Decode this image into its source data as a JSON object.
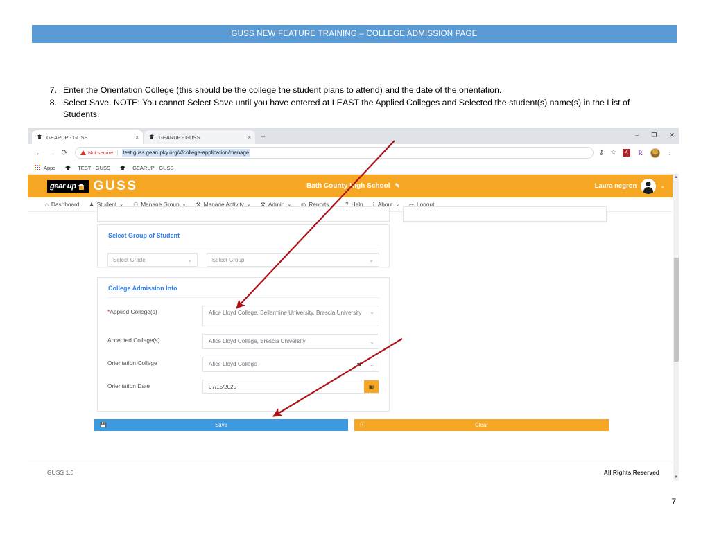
{
  "slide": {
    "banner_title": "GUSS NEW FEATURE TRAINING – COLLEGE ADMISSION PAGE",
    "page_number": "7",
    "instructions": [
      {
        "number": "7.",
        "text": "Enter the Orientation College (this should be the college the student plans to attend) and the date of the orientation."
      },
      {
        "number": "8.",
        "text": "Select Save. NOTE: You cannot Select Save until you have entered at LEAST the Applied Colleges and Selected the student(s) name(s) in the List of Students."
      }
    ],
    "accent_banner_color": "#5b9bd5",
    "annotation_arrow_color": "#b01116"
  },
  "browser": {
    "tabs": [
      {
        "title": "GEARUP - GUSS",
        "close": "×",
        "favicon": "gearup-favicon"
      },
      {
        "title": "GEARUP - GUSS",
        "close": "×",
        "favicon": "gearup-favicon"
      }
    ],
    "new_tab": "+",
    "window_controls": {
      "minimize": "–",
      "maximize": "❐",
      "close": "✕"
    },
    "nav": {
      "back": "←",
      "forward": "→",
      "reload": "⟳"
    },
    "security_label": "Not secure",
    "url": "test.guss.gearupky.org/#/college-application/manage",
    "toolbar_icons": {
      "key": "⚷",
      "star": "☆",
      "ext_adobe": "A",
      "ext_r": "R",
      "menu": "⋮"
    },
    "bookmarks": [
      {
        "label": "Apps",
        "icon": "apps-grid-icon"
      },
      {
        "label": "TEST - GUSS",
        "icon": "gearup-favicon"
      },
      {
        "label": "GEARUP - GUSS",
        "icon": "gearup-favicon"
      }
    ]
  },
  "app": {
    "brand": {
      "logo_text": "gear up",
      "name": "GUSS"
    },
    "school_name": "Bath County High School",
    "school_edit_icon": "✎",
    "user": {
      "name": "Laura negron",
      "caret": "⌄"
    },
    "nav_items": [
      {
        "label": "Dashboard",
        "icon": "⌂",
        "caret": ""
      },
      {
        "label": "Student",
        "icon": "♟",
        "caret": "⌄"
      },
      {
        "label": "Manage Group",
        "icon": "⚇",
        "caret": "⌄"
      },
      {
        "label": "Manage Activity",
        "icon": "⚒",
        "caret": "⌄"
      },
      {
        "label": "Admin",
        "icon": "⚒",
        "caret": "⌄"
      },
      {
        "label": "Reports",
        "icon": "◎",
        "caret": "⌄"
      },
      {
        "label": "Help",
        "icon": "?",
        "caret": ""
      },
      {
        "label": "About",
        "icon": "ℹ",
        "caret": "⌄"
      },
      {
        "label": "Logout",
        "icon": "↦",
        "caret": ""
      }
    ],
    "header_color": "#f5a623"
  },
  "group_card": {
    "title": "Select Group of Student",
    "grade_select": {
      "value": "Select Grade",
      "caret": "⌄"
    },
    "group_select": {
      "value": "Select Group",
      "caret": "⌄"
    }
  },
  "admission_card": {
    "title": "College Admission Info",
    "fields": [
      {
        "label": "Applied College(s)",
        "required": true,
        "required_mark": "*",
        "value": "Alice Lloyd College, Bellarmine University, Brescia University",
        "caret": "⌄"
      },
      {
        "label": "Accepted College(s)",
        "required": false,
        "value": "Alice Lloyd College, Brescia University",
        "caret": "⌄"
      },
      {
        "label": "Orientation College",
        "required": false,
        "value": "Alice Lloyd College",
        "clear": "✖",
        "caret": "⌄"
      }
    ],
    "date_field": {
      "label": "Orientation Date",
      "value": "07/15/2020",
      "calendar_icon": "▣"
    }
  },
  "actions": {
    "save": {
      "label": "Save",
      "icon": "Ὃe",
      "color": "#3d9ae0"
    },
    "clear": {
      "label": "Clear",
      "icon": "ⓧ",
      "color": "#f5a623"
    }
  },
  "footer": {
    "version": "GUSS 1.0",
    "rights": "All Rights Reserved"
  }
}
